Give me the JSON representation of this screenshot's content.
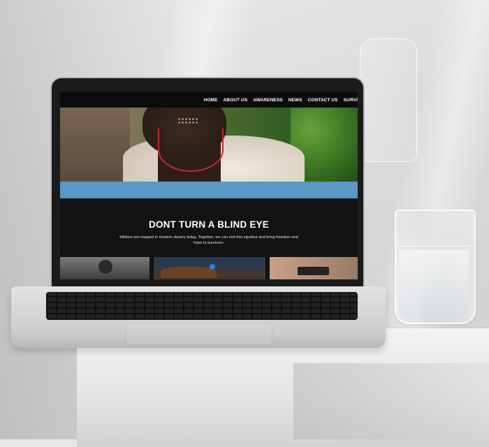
{
  "website": {
    "nav": {
      "items": [
        "HOME",
        "ABOUT US",
        "AWARENESS",
        "NEWS",
        "CONTACT US",
        "SURVI"
      ]
    },
    "headline": "DONT TURN A BLIND EYE",
    "subtext": "Millions are trapped in modern slavery today. Together, we can end this injustice and bring freedom and hope to survivors."
  },
  "colors": {
    "nav_bg": "#0c0c0c",
    "band": "#5b98c6",
    "content_bg": "#121212",
    "text": "#ffffff"
  }
}
